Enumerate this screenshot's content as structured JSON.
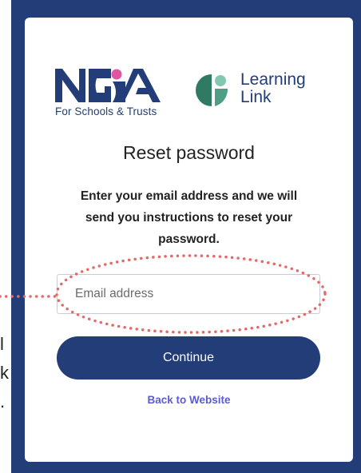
{
  "brand": {
    "nga_tagline": "For Schools & Trusts",
    "learning_link_line1": "Learning",
    "learning_link_line2": "Link",
    "colors": {
      "navy": "#223d78",
      "pink": "#e0569e",
      "green_dark": "#2f7a63",
      "green_light": "#82c7b0"
    }
  },
  "reset": {
    "title": "Reset password",
    "instructions": "Enter your email address and we will send you instructions to reset your password.",
    "email_value": "",
    "email_placeholder": "Email address",
    "continue_label": "Continue",
    "back_label": "Back to Website"
  },
  "edge_glyphs": [
    "l",
    "k",
    "."
  ],
  "annotation": {
    "color": "#e46a6a",
    "shape": "dotted-ellipse",
    "target": "email-input"
  }
}
